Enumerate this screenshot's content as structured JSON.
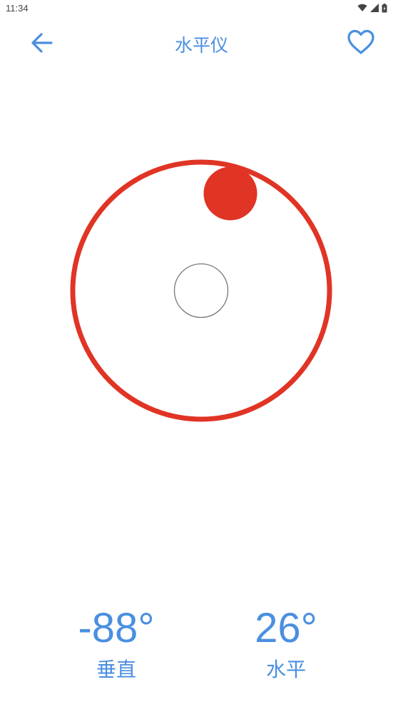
{
  "status_bar": {
    "time": "11:34",
    "icons": [
      "wifi-icon",
      "signal-icon",
      "battery-icon"
    ]
  },
  "app_bar": {
    "title": "水平仪",
    "back_icon": "arrow-left-icon",
    "favorite_icon": "heart-outline-icon"
  },
  "level": {
    "bubble_vertical_deg": -88,
    "bubble_horizontal_deg": 26
  },
  "readouts": {
    "vertical": {
      "value": "-88°",
      "label": "垂直"
    },
    "horizontal": {
      "value": "26°",
      "label": "水平"
    }
  },
  "colors": {
    "accent": "#4a8fe0",
    "level_ring": "#e03425",
    "bubble": "#e03425",
    "center_ring": "#777777",
    "status_text": "#444444"
  }
}
